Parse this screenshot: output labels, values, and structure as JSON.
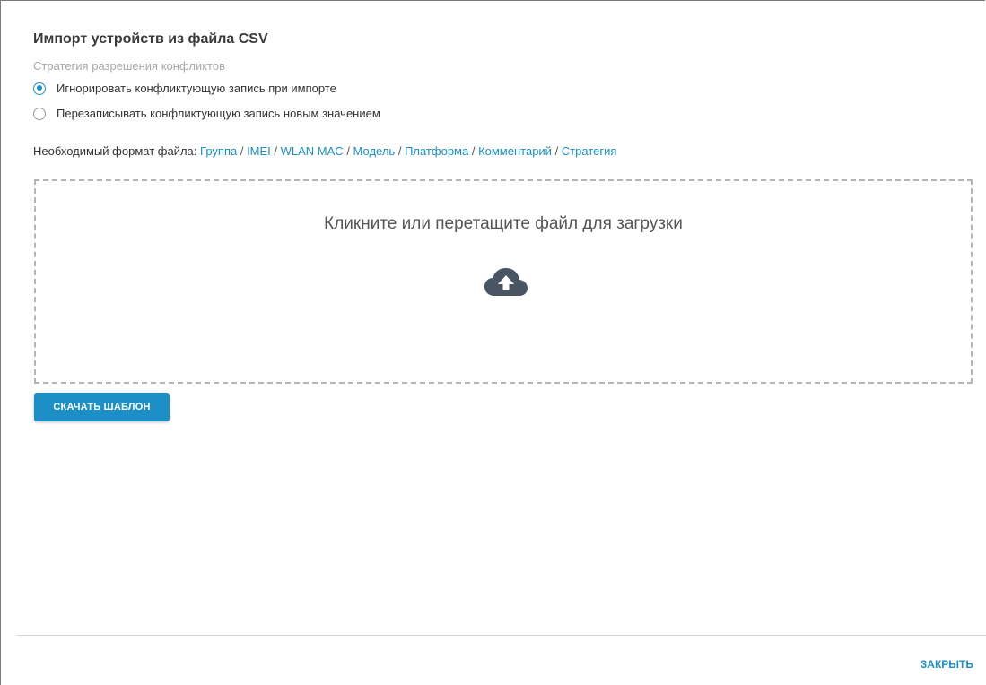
{
  "dialog": {
    "title": "Импорт устройств из файла CSV",
    "strategy_caption": "Стратегия разрешения конфликтов",
    "options": [
      {
        "label": "Игнорировать конфликтующую запись при импорте",
        "selected": true
      },
      {
        "label": "Перезаписывать конфликтующую запись новым значением",
        "selected": false
      }
    ],
    "format_prefix": "Необходимый формат файла:",
    "format_fields": [
      "Группа",
      "IMEI",
      "WLAN MAC",
      "Модель",
      "Платформа",
      "Комментарий",
      "Стратегия"
    ],
    "format_separator": " / ",
    "dropzone_text": "Кликните или перетащите файл для загрузки",
    "dropzone_icon": "cloud-upload-icon",
    "download_button": "СКАЧАТЬ ШАБЛОН",
    "close_button": "ЗАКРЫТЬ"
  },
  "colors": {
    "accent": "#1b8fc6",
    "icon": "#4a5563",
    "dashed_border": "#b5b5b5"
  }
}
